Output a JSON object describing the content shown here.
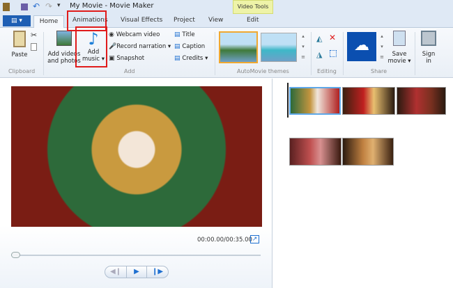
{
  "window": {
    "title": "My Movie - Movie Maker"
  },
  "tabs": {
    "file": "▤ ▾",
    "items": [
      "Home",
      "Animations",
      "Visual Effects",
      "Project",
      "View"
    ],
    "contextual_group": "Video Tools",
    "contextual_tab": "Edit",
    "active": "Home"
  },
  "ribbon": {
    "clipboard": {
      "group": "Clipboard",
      "paste": "Paste"
    },
    "add": {
      "group": "Add",
      "add_videos": "Add videos",
      "add_videos2": "and photos",
      "add_music": "Add",
      "add_music2": "music ▾",
      "webcam": "Webcam video",
      "narration": "Record narration ▾",
      "snapshot": "Snapshot",
      "title": "Title",
      "caption": "Caption",
      "credits": "Credits ▾"
    },
    "themes": {
      "group": "AutoMovie themes"
    },
    "editing": {
      "group": "Editing"
    },
    "share": {
      "group": "Share",
      "save": "Save",
      "save2": "movie ▾"
    },
    "signin": {
      "label": "Sign",
      "label2": "in"
    }
  },
  "player": {
    "time": "00:00.00/00:35.00",
    "progress": 0
  },
  "highlight_color": "#e01b1b"
}
